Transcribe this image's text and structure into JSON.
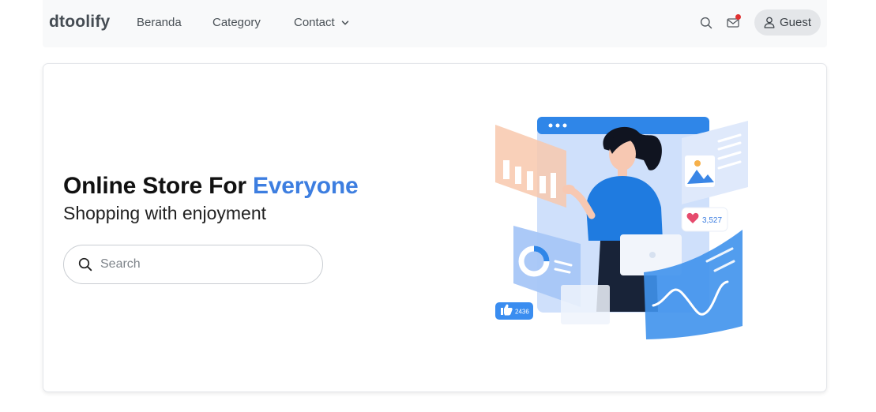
{
  "navbar": {
    "brand": "dtoolify",
    "links": [
      {
        "label": "Beranda"
      },
      {
        "label": "Category"
      },
      {
        "label": "Contact"
      }
    ],
    "guest_label": "Guest"
  },
  "hero": {
    "title_prefix": "Online Store For ",
    "title_accent": "Everyone",
    "subtitle": "Shopping with enjoyment",
    "search_placeholder": "Search"
  },
  "illustration": {
    "likes_count": "3,527",
    "thumbs_count": "2436"
  },
  "colors": {
    "accent": "#3d7ee0",
    "navbar_bg": "#f8f9fa",
    "notification_dot": "#e03131"
  },
  "icons": [
    "search-icon",
    "mail-icon",
    "user-icon",
    "chevron-down-icon",
    "heart-icon",
    "thumbs-up-icon"
  ]
}
